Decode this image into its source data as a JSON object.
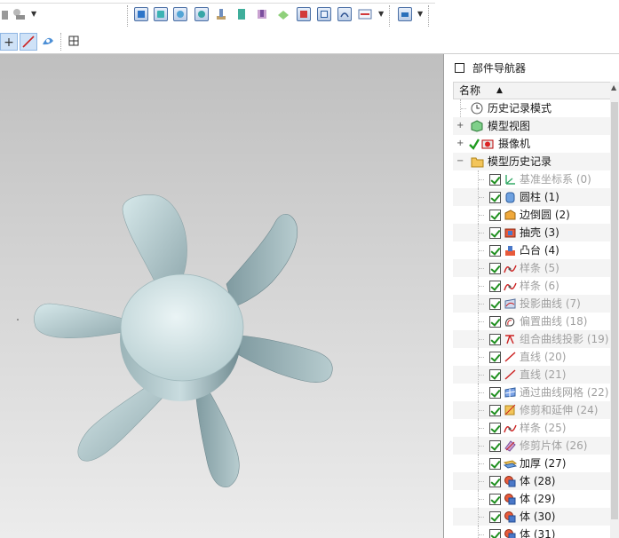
{
  "toolbar": {
    "row1_buttons": [
      "cylinder-feature-icon",
      "extrude-icon",
      "revolve-icon",
      "sphere-icon",
      "boss-icon",
      "pad-icon",
      "pocket-icon",
      "blend-icon",
      "shell-icon",
      "grid-icon",
      "curve-icon",
      "offset-icon",
      "layer-icon"
    ],
    "row2_buttons": [
      "point-icon",
      "line-icon",
      "snap-icon",
      "table-icon"
    ]
  },
  "navigator": {
    "title": "部件导航器",
    "column_header": "名称",
    "sort_arrow": "▲",
    "top_items": [
      {
        "label": "历史记录模式",
        "icon": "clock-icon"
      },
      {
        "label": "模型视图",
        "icon": "model-views-icon"
      },
      {
        "label": "摄像机",
        "icon": "camera-icon"
      },
      {
        "label": "模型历史记录",
        "icon": "folder-icon"
      }
    ],
    "features": [
      {
        "label": "基准坐标系 (0)",
        "dim": true,
        "icon": "datum-csys-icon"
      },
      {
        "label": "圆柱 (1)",
        "dim": false,
        "icon": "cylinder-icon"
      },
      {
        "label": "边倒圆 (2)",
        "dim": false,
        "icon": "edge-blend-icon"
      },
      {
        "label": "抽壳 (3)",
        "dim": false,
        "icon": "shell-icon"
      },
      {
        "label": "凸台 (4)",
        "dim": false,
        "icon": "boss-icon"
      },
      {
        "label": "样条 (5)",
        "dim": true,
        "icon": "spline-icon"
      },
      {
        "label": "样条 (6)",
        "dim": true,
        "icon": "spline-icon"
      },
      {
        "label": "投影曲线 (7)",
        "dim": true,
        "icon": "projected-curve-icon"
      },
      {
        "label": "偏置曲线 (18)",
        "dim": true,
        "icon": "offset-curve-icon"
      },
      {
        "label": "组合曲线投影 (19)",
        "dim": true,
        "icon": "combined-projection-icon"
      },
      {
        "label": "直线 (20)",
        "dim": true,
        "icon": "line-icon"
      },
      {
        "label": "直线 (21)",
        "dim": true,
        "icon": "line-icon"
      },
      {
        "label": "通过曲线网格 (22)",
        "dim": true,
        "icon": "through-curve-mesh-icon"
      },
      {
        "label": "修剪和延伸 (24)",
        "dim": true,
        "icon": "trim-extend-icon"
      },
      {
        "label": "样条 (25)",
        "dim": true,
        "icon": "spline-icon"
      },
      {
        "label": "修剪片体 (26)",
        "dim": true,
        "icon": "trim-sheet-icon"
      },
      {
        "label": "加厚 (27)",
        "dim": false,
        "icon": "thicken-icon"
      },
      {
        "label": "体 (28)",
        "dim": false,
        "icon": "body-icon"
      },
      {
        "label": "体 (29)",
        "dim": false,
        "icon": "body-icon"
      },
      {
        "label": "体 (30)",
        "dim": false,
        "icon": "body-icon"
      },
      {
        "label": "体 (31)",
        "dim": false,
        "icon": "body-icon"
      }
    ]
  }
}
